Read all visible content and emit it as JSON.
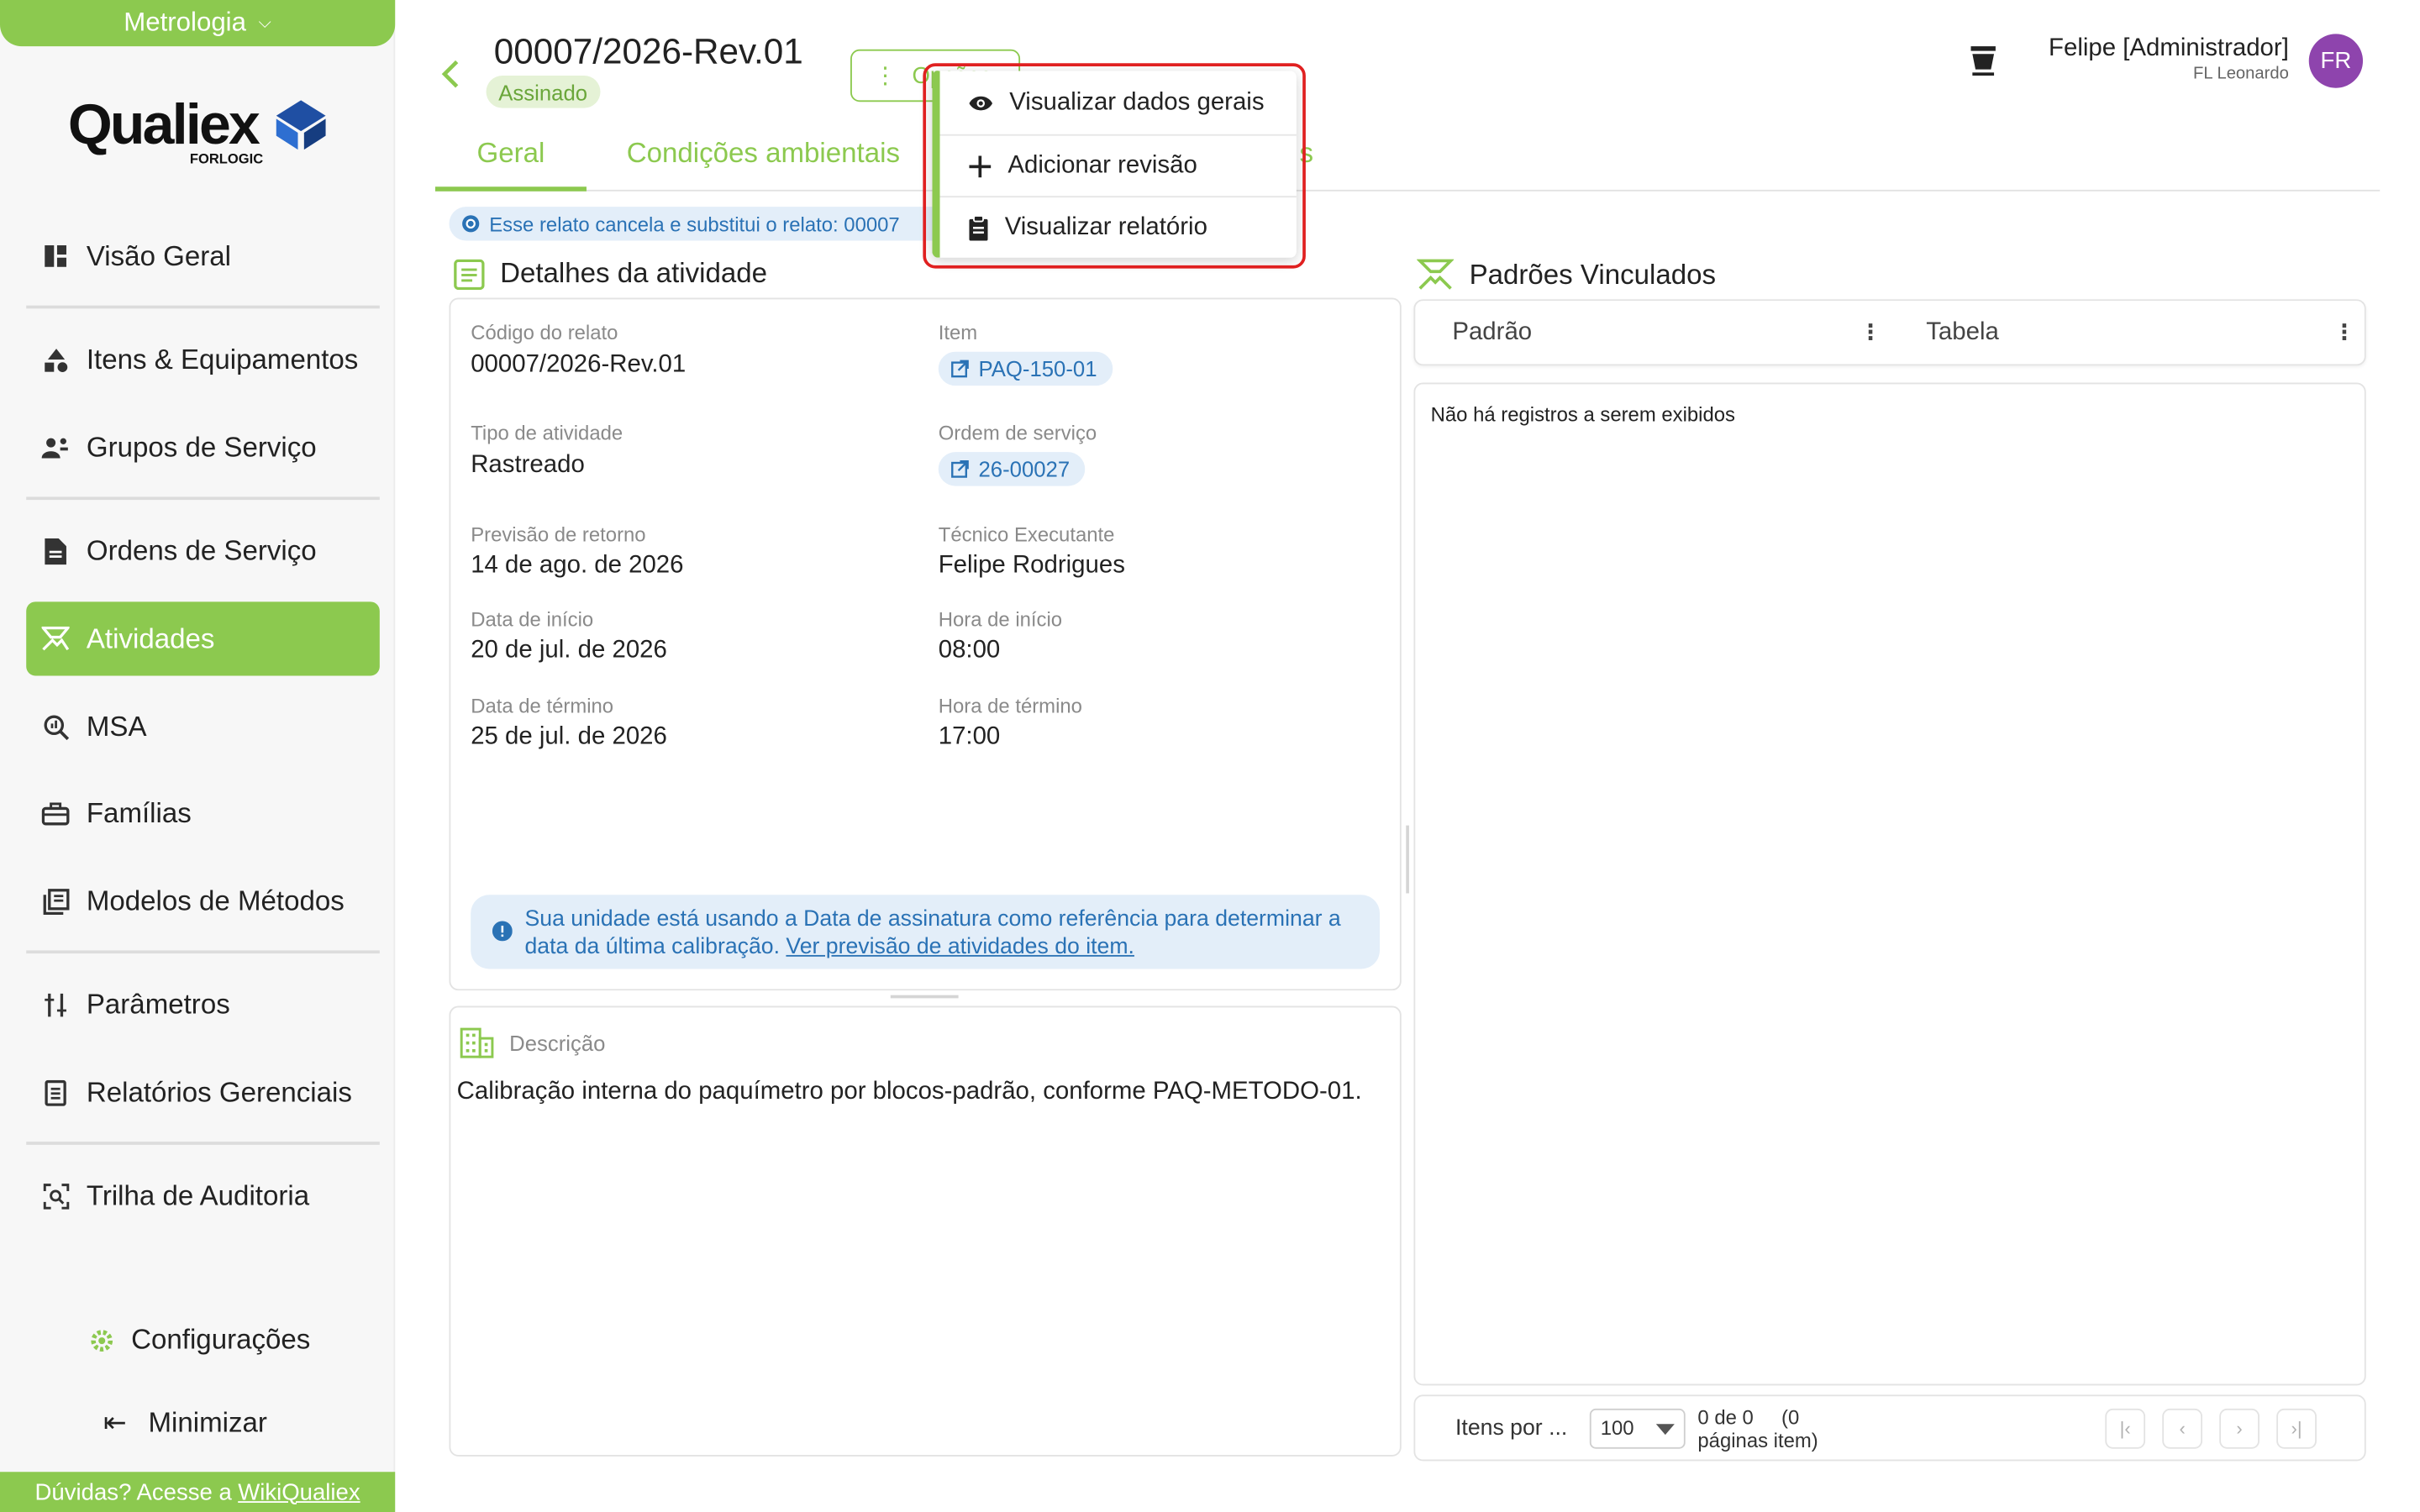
{
  "module": {
    "label": "Metrologia"
  },
  "logo": {
    "word": "Qualiex",
    "sub": "FORLOGIC"
  },
  "nav": {
    "items": [
      {
        "label": "Visão Geral"
      },
      {
        "label": "Itens & Equipamentos"
      },
      {
        "label": "Grupos de Serviço"
      },
      {
        "label": "Ordens de Serviço"
      },
      {
        "label": "Atividades"
      },
      {
        "label": "MSA"
      },
      {
        "label": "Famílias"
      },
      {
        "label": "Modelos de Métodos"
      },
      {
        "label": "Parâmetros"
      },
      {
        "label": "Relatórios Gerenciais"
      },
      {
        "label": "Trilha de Auditoria"
      }
    ],
    "active": "Atividades",
    "config": "Configurações",
    "minimize": "Minimizar"
  },
  "help": {
    "prefix": "Dúvidas? Acesse a",
    "link": "WikiQualiex"
  },
  "header": {
    "title": "00007/2026-Rev.01",
    "status": "Assinado",
    "options_label": "Opções",
    "user_name": "Felipe [Administrador]",
    "user_sub": "FL Leonardo",
    "avatar": "FR"
  },
  "tabs": [
    {
      "label": "Geral"
    },
    {
      "label": "Condições ambientais"
    },
    {
      "label": "s"
    }
  ],
  "replace_note": "Esse relato cancela e substitui o relato: 00007",
  "details": {
    "title": "Detalhes da atividade",
    "fields": {
      "codigo_label": "Código do relato",
      "codigo_value": "00007/2026-Rev.01",
      "item_label": "Item",
      "item_value": "PAQ-150-01",
      "tipo_label": "Tipo de atividade",
      "tipo_value": "Rastreado",
      "os_label": "Ordem de serviço",
      "os_value": "26-00027",
      "retorno_label": "Previsão de retorno",
      "retorno_value": "14 de ago. de 2026",
      "tecnico_label": "Técnico Executante",
      "tecnico_value": "Felipe Rodrigues",
      "inicio_label": "Data de início",
      "inicio_value": "20 de jul. de 2026",
      "hora_inicio_label": "Hora de início",
      "hora_inicio_value": "08:00",
      "termino_label": "Data de término",
      "termino_value": "25 de jul. de 2026",
      "hora_termino_label": "Hora de término",
      "hora_termino_value": "17:00"
    },
    "callout_text": "Sua unidade está usando a Data de assinatura como referência para determinar a data da última calibração.",
    "callout_link": "Ver previsão de atividades do item."
  },
  "description": {
    "label": "Descrição",
    "text": "Calibração interna do paquímetro por blocos-padrão, conforme PAQ-METODO-01."
  },
  "standards": {
    "title": "Padrões Vinculados",
    "columns": [
      "Padrão",
      "Tabela"
    ],
    "empty": "Não há registros a serem exibidos"
  },
  "pager": {
    "label": "Itens por ...",
    "page_size": "100",
    "range": "0 de 0",
    "range2": "(0",
    "unit": "páginas item)"
  },
  "menu": {
    "items": [
      {
        "label": "Visualizar dados gerais"
      },
      {
        "label": "Adicionar revisão"
      },
      {
        "label": "Visualizar relatório"
      }
    ]
  },
  "colors": {
    "accent": "#8cc94f",
    "info": "#2a72b5",
    "highlight": "#e02020",
    "avatar": "#8e44ad"
  }
}
